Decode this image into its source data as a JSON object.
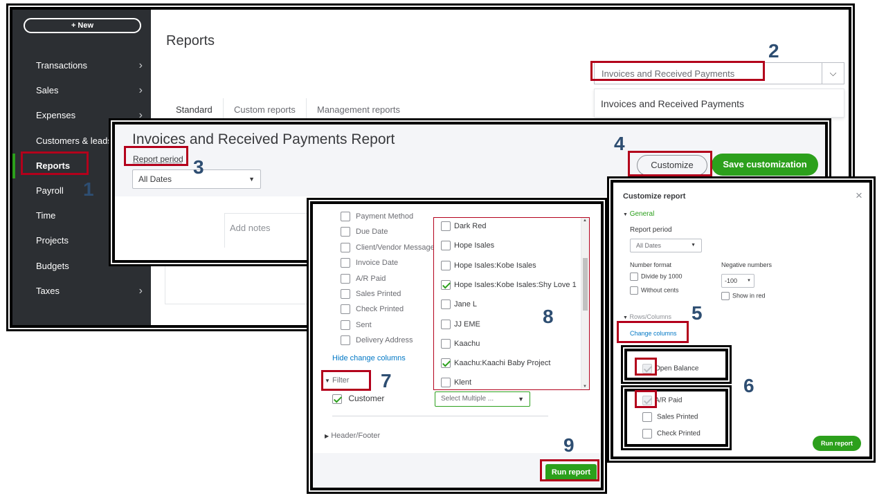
{
  "sidebar": {
    "new_label": "+ New",
    "items": [
      {
        "label": "Transactions",
        "chevron": true
      },
      {
        "label": "Sales",
        "chevron": true
      },
      {
        "label": "Expenses",
        "chevron": true
      },
      {
        "label": "Customers & leads",
        "chevron": false
      },
      {
        "label": "Reports",
        "chevron": false,
        "active": true
      },
      {
        "label": "Payroll",
        "chevron": false
      },
      {
        "label": "Time",
        "chevron": false
      },
      {
        "label": "Projects",
        "chevron": false
      },
      {
        "label": "Budgets",
        "chevron": false
      },
      {
        "label": "Taxes",
        "chevron": true
      }
    ]
  },
  "reports": {
    "title": "Reports",
    "search_value": "Invoices and Received Payments",
    "suggestion": "Invoices and Received Payments",
    "tabs": [
      "Standard",
      "Custom reports",
      "Management reports"
    ]
  },
  "report_header": {
    "title": "Invoices and Received Payments Report",
    "period_label": "Report period",
    "period_value": "All Dates",
    "customize_label": "Customize",
    "save_label": "Save customization",
    "add_notes": "Add notes"
  },
  "columns_panel": {
    "columns": [
      {
        "label": "Payment Method",
        "checked": false
      },
      {
        "label": "Due Date",
        "checked": false
      },
      {
        "label": "Client/Vendor Message",
        "checked": false
      },
      {
        "label": "Invoice Date",
        "checked": false
      },
      {
        "label": "A/R Paid",
        "checked": false
      },
      {
        "label": "Sales Printed",
        "checked": false
      },
      {
        "label": "Check Printed",
        "checked": false
      },
      {
        "label": "Sent",
        "checked": false
      },
      {
        "label": "Delivery Address",
        "checked": false
      }
    ],
    "hide_link": "Hide change columns",
    "filter_label": "Filter",
    "customer_label": "Customer",
    "customer_select": "Select Multiple ...",
    "header_footer": "Header/Footer",
    "run_label": "Run report"
  },
  "customer_list": [
    {
      "label": "Dark Red",
      "checked": false
    },
    {
      "label": "Hope Isales",
      "checked": false
    },
    {
      "label": "Hope Isales:Kobe Isales",
      "checked": false
    },
    {
      "label": "Hope Isales:Kobe Isales:Shy Love 1",
      "checked": true
    },
    {
      "label": "Jane L",
      "checked": false
    },
    {
      "label": "JJ EME",
      "checked": false
    },
    {
      "label": "Kaachu",
      "checked": false
    },
    {
      "label": "Kaachu:Kaachi Baby Project",
      "checked": true
    },
    {
      "label": "Klent",
      "checked": false
    }
  ],
  "customize_panel": {
    "title": "Customize report",
    "close": "×",
    "general": "General",
    "period_label": "Report period",
    "period_value": "All Dates",
    "number_format": "Number format",
    "divide": "Divide by 1000",
    "without_cents": "Without cents",
    "negative_label": "Negative numbers",
    "negative_value": "-100",
    "show_red": "Show in red",
    "rows_columns": "Rows/Columns",
    "change_columns": "Change columns",
    "open_balance": "Open Balance",
    "ar_paid": "A/R Paid",
    "sales_printed": "Sales Printed",
    "check_printed": "Check Printed",
    "run_label": "Run report"
  },
  "callouts": [
    "1",
    "2",
    "3",
    "4",
    "5",
    "6",
    "7",
    "8",
    "9"
  ],
  "colors": {
    "accent": "#2ca01c",
    "highlight": "#b3001b",
    "sidebar": "#2c2f33",
    "callout": "#2e4e72"
  }
}
